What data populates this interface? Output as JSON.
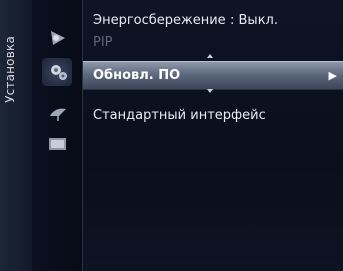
{
  "sidebar": {
    "label": "Установка"
  },
  "icons": [
    "picture-icon",
    "gear-settings-icon",
    "satellite-dish-icon",
    "input-icon"
  ],
  "menu": {
    "items": [
      {
        "label": "Энергосбережение",
        "value": ": Выкл."
      },
      {
        "label": "PIP"
      },
      {
        "label": "Обновл. ПО"
      },
      {
        "label": "Стандартный интерфейс"
      }
    ]
  }
}
